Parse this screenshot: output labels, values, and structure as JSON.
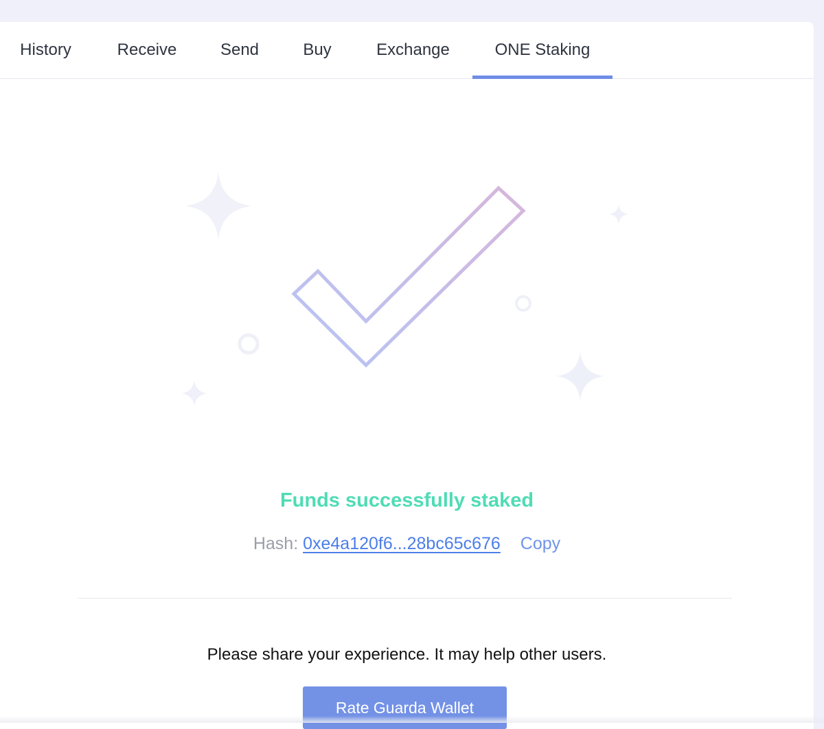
{
  "tabs": [
    {
      "label": "History"
    },
    {
      "label": "Receive"
    },
    {
      "label": "Send"
    },
    {
      "label": "Buy"
    },
    {
      "label": "Exchange"
    },
    {
      "label": "ONE Staking",
      "active": true
    }
  ],
  "result": {
    "title": "Funds successfully staked",
    "hash_label": "Hash:",
    "hash_value": "0xe4a120f6...28bc65c676",
    "copy_label": "Copy"
  },
  "feedback": {
    "prompt": "Please share your experience. It may help other users.",
    "button_label": "Rate Guarda Wallet"
  },
  "icons": {
    "illustration": "checkmark-icon",
    "decor": [
      "sparkle-icon",
      "circle-icon"
    ]
  },
  "colors": {
    "accent": "#6f8de6",
    "success": "#4fdcb5",
    "link": "#4b7ee8",
    "button": "#7392e6",
    "check_gradient_start": "#b6c5f5",
    "check_gradient_end": "#d6b6db"
  }
}
